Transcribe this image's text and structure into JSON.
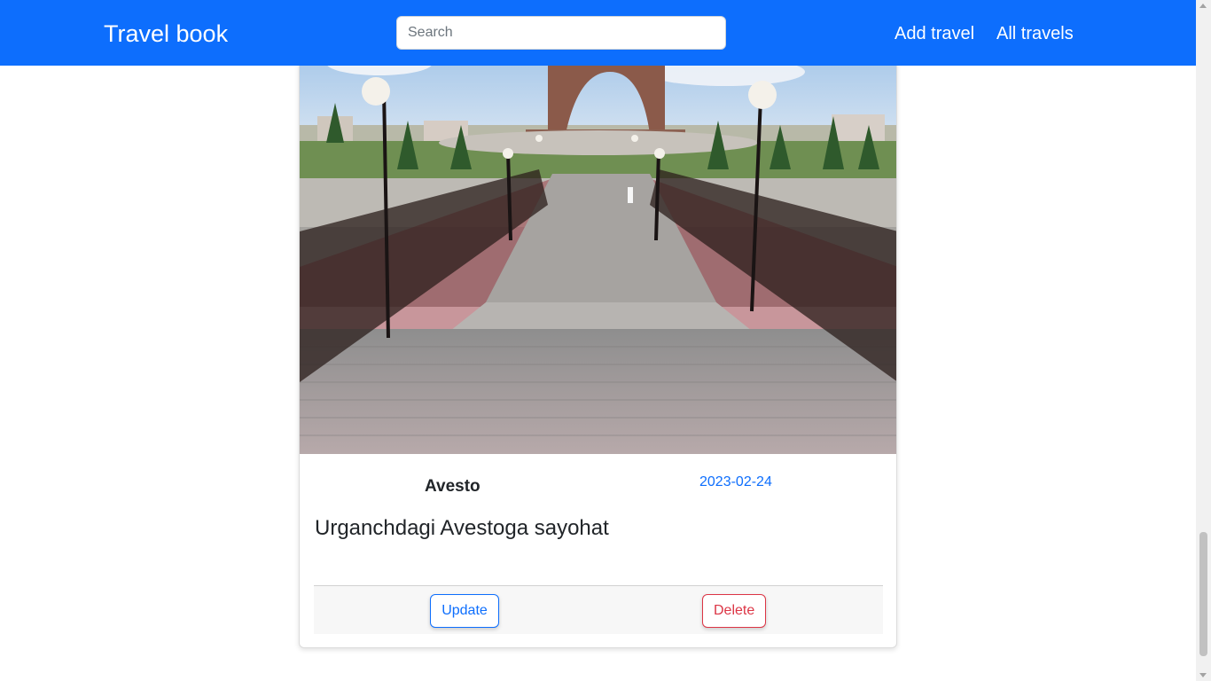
{
  "navbar": {
    "brand": "Travel book",
    "search_placeholder": "Search",
    "search_value": "",
    "links": {
      "add": "Add travel",
      "all": "All travels"
    },
    "color": "#0d6efd"
  },
  "card": {
    "place": "Avesto",
    "date": "2023-02-24",
    "description": "Urganchdagi Avestoga sayohat",
    "update_label": "Update",
    "delete_label": "Delete"
  },
  "colors": {
    "primary": "#0d6efd",
    "danger": "#dc3545"
  }
}
